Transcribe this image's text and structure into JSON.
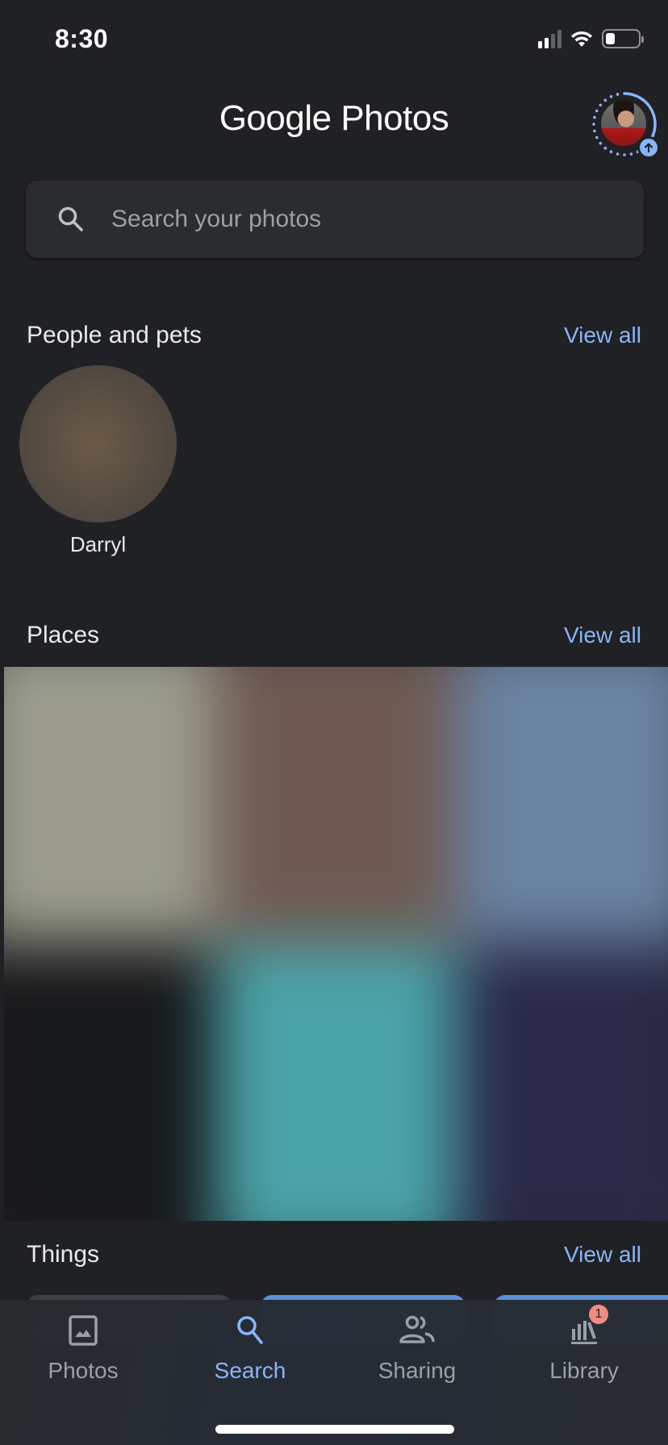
{
  "status_bar": {
    "time": "8:30",
    "signal_bars_active": 2,
    "signal_bars_total": 4,
    "battery_level": 0.3
  },
  "header": {
    "title_brand": "Google",
    "title_product": "Photos",
    "account": {
      "avatar_icon": "profile-photo",
      "backup_progress": 0.35,
      "backup_badge_icon": "arrow-up-icon"
    }
  },
  "search": {
    "placeholder": "Search your photos",
    "value": "",
    "icon": "search-icon"
  },
  "sections": {
    "people": {
      "title": "People and pets",
      "view_all": "View all",
      "items": [
        {
          "name": "Darryl"
        }
      ]
    },
    "places": {
      "title": "Places",
      "view_all": "View all",
      "tiles": [
        {
          "color": "#9c9d8e"
        },
        {
          "color": "#6e5a52"
        },
        {
          "color": "#6a84a3"
        },
        {
          "color": "#17181a"
        },
        {
          "color": "#4aa3a8"
        },
        {
          "color": "#2a2a48"
        }
      ]
    },
    "things": {
      "title": "Things",
      "view_all": "View all",
      "cards": [
        {
          "color": "#3c4043"
        },
        {
          "color": "#5b8fd9"
        },
        {
          "color": "#5b8fd9"
        }
      ]
    }
  },
  "bottom_nav": {
    "active": "search",
    "items": [
      {
        "id": "photos",
        "label": "Photos",
        "icon": "photo-icon"
      },
      {
        "id": "search",
        "label": "Search",
        "icon": "search-icon"
      },
      {
        "id": "sharing",
        "label": "Sharing",
        "icon": "people-icon"
      },
      {
        "id": "library",
        "label": "Library",
        "icon": "library-icon",
        "badge": "1"
      }
    ]
  },
  "colors": {
    "background": "#202124",
    "accent": "#8ab4f8",
    "badge": "#f28b82",
    "muted_text": "#9aa0a6"
  }
}
